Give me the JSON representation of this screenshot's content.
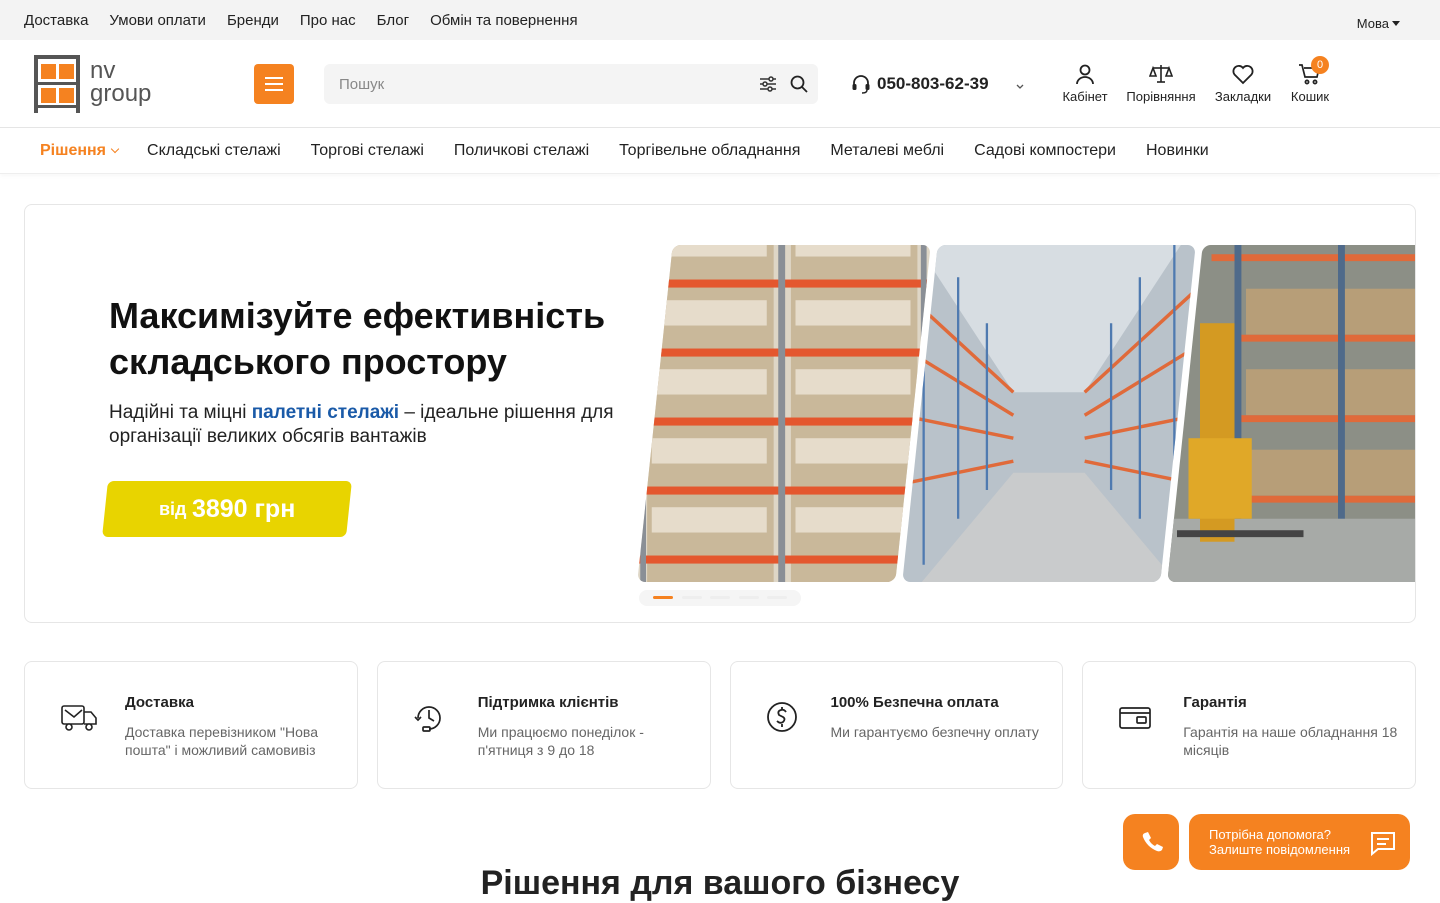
{
  "topbar": {
    "links": [
      "Доставка",
      "Умови оплати",
      "Бренди",
      "Про нас",
      "Блог",
      "Обмін та повернення"
    ],
    "lang": "Мова"
  },
  "logo": {
    "line1": "nv",
    "line2": "group"
  },
  "search": {
    "placeholder": "Пошук"
  },
  "phone": "050-803-62-39",
  "header_icons": {
    "cabinet": "Кабінет",
    "compare": "Порівняння",
    "bookmarks": "Закладки",
    "cart": "Кошик",
    "cart_count": "0"
  },
  "nav": [
    "Рішення",
    "Складські стелажі",
    "Торгові стелажі",
    "Поличкові стелажі",
    "Торгівельне обладнання",
    "Металеві меблі",
    "Садові компостери",
    "Новинки"
  ],
  "hero": {
    "title": "Максимізуйте ефективність складського простору",
    "sub_before": "Надійні та міцні ",
    "sub_highlight": "палетні стелажі",
    "sub_after": " – ідеальне рішення для організації великих обсягів вантажів",
    "price_prefix": "від",
    "price": "3890 грн",
    "slides": 5,
    "active_slide": 1
  },
  "features": [
    {
      "icon": "truck-icon",
      "title": "Доставка",
      "text": "Доставка перевізником \"Нова пошта\" і можливий самовивіз"
    },
    {
      "icon": "support-clock-icon",
      "title": "Підтримка клієнтів",
      "text": "Ми працюємо понеділок - п'ятниця з 9 до 18"
    },
    {
      "icon": "secure-payment-icon",
      "title": "100% Безпечна оплата",
      "text": "Ми гарантуємо безпечну оплату"
    },
    {
      "icon": "card-icon",
      "title": "Гарантія",
      "text": "Гарантія на наше обладнання 18 місяців"
    }
  ],
  "section_title": "Рішення для вашого бізнесу",
  "help": {
    "line1": "Потрібна допомога?",
    "line2": "Залиште повідомлення"
  },
  "colors": {
    "accent": "#f58220",
    "price_bg": "#e8d400",
    "highlight": "#1a5aa8"
  }
}
